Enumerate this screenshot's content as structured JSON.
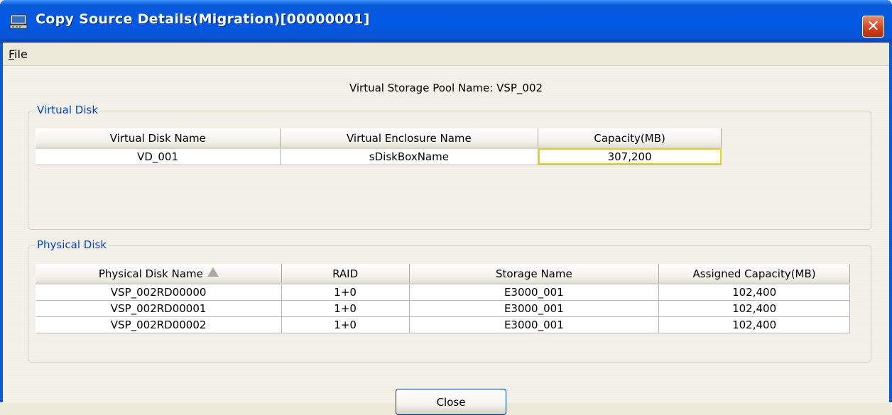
{
  "window": {
    "title": "Copy Source Details(Migration)[00000001]",
    "close_glyph": "✕"
  },
  "menu": {
    "file_mnemonic": "F",
    "file_rest": "ile"
  },
  "pool": {
    "label": "Virtual Storage Pool Name: VSP_002"
  },
  "virtual_disk": {
    "group_label": "Virtual Disk",
    "headers": [
      "Virtual Disk Name",
      "Virtual Enclosure Name",
      "Capacity(MB)"
    ],
    "rows": [
      [
        "VD_001",
        "sDiskBoxName",
        "307,200"
      ]
    ]
  },
  "physical_disk": {
    "group_label": "Physical Disk",
    "headers": [
      "Physical Disk Name",
      "RAID",
      "Storage Name",
      "Assigned Capacity(MB)"
    ],
    "sort_icon": "sort-ascending-icon",
    "rows": [
      [
        "VSP_002RD00000",
        "1+0",
        "E3000_001",
        "102,400"
      ],
      [
        "VSP_002RD00001",
        "1+0",
        "E3000_001",
        "102,400"
      ],
      [
        "VSP_002RD00002",
        "1+0",
        "E3000_001",
        "102,400"
      ]
    ]
  },
  "buttons": {
    "close": "Close"
  },
  "colors": {
    "title_bar": "#0058e6",
    "group_label": "#0046d5",
    "selected_cell_outline": "#e3d51b",
    "close_button": "#d0401a"
  }
}
